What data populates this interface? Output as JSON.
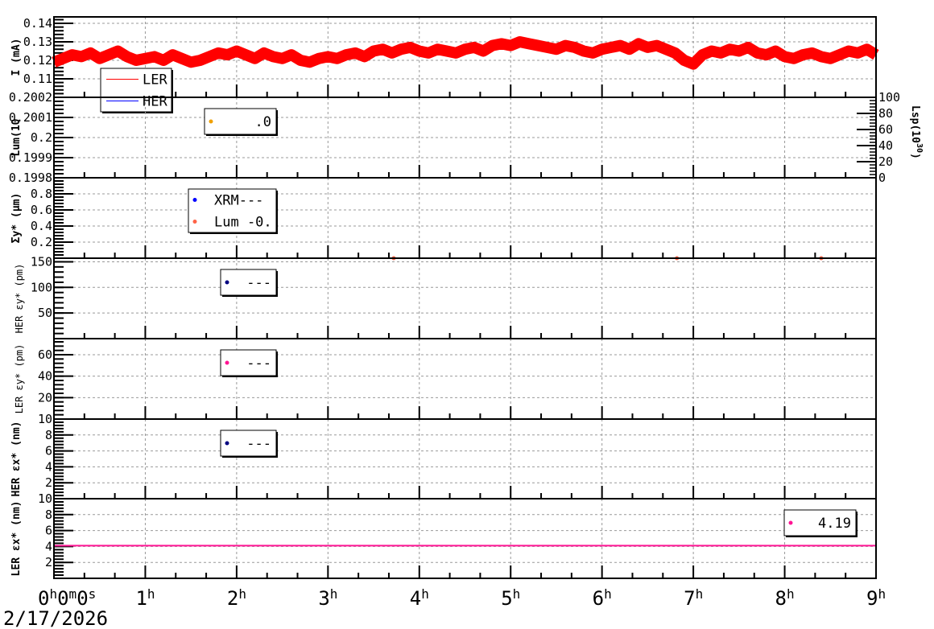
{
  "chart_data": [
    {
      "type": "line",
      "ylabel": "I (mA)",
      "ylim": [
        0.1,
        0.1435
      ],
      "yticks": [
        "0.11",
        "0.12",
        "0.13",
        "0.14"
      ],
      "ytick_values": [
        0.11,
        0.12,
        0.13,
        0.14
      ],
      "legend": [
        {
          "label": "LER",
          "color": "#ff0000"
        },
        {
          "label": "HER",
          "color": "#0000ff"
        }
      ],
      "series": [
        {
          "name": "LER",
          "color": "#ff0000",
          "x_hours": [
            0,
            0.1,
            0.2,
            0.3,
            0.4,
            0.5,
            0.6,
            0.7,
            0.8,
            0.9,
            1,
            1.1,
            1.2,
            1.3,
            1.4,
            1.5,
            1.6,
            1.7,
            1.8,
            1.9,
            2,
            2.1,
            2.2,
            2.3,
            2.4,
            2.5,
            2.6,
            2.7,
            2.8,
            2.9,
            3,
            3.1,
            3.2,
            3.3,
            3.4,
            3.5,
            3.6,
            3.7,
            3.8,
            3.9,
            4,
            4.1,
            4.2,
            4.3,
            4.4,
            4.5,
            4.6,
            4.7,
            4.8,
            4.9,
            5,
            5.1,
            5.2,
            5.3,
            5.4,
            5.5,
            5.6,
            5.7,
            5.8,
            5.9,
            6,
            6.1,
            6.2,
            6.3,
            6.4,
            6.5,
            6.6,
            6.7,
            6.8,
            6.9,
            7,
            7.1,
            7.2,
            7.3,
            7.4,
            7.5,
            7.6,
            7.7,
            7.8,
            7.9,
            8,
            8.1,
            8.2,
            8.3,
            8.4,
            8.5,
            8.6,
            8.7,
            8.8,
            8.9,
            9
          ],
          "values": [
            0.119,
            0.121,
            0.123,
            0.122,
            0.124,
            0.121,
            0.123,
            0.125,
            0.122,
            0.12,
            0.121,
            0.122,
            0.12,
            0.123,
            0.121,
            0.119,
            0.12,
            0.122,
            0.124,
            0.123,
            0.125,
            0.123,
            0.121,
            0.124,
            0.122,
            0.121,
            0.123,
            0.12,
            0.119,
            0.121,
            0.122,
            0.121,
            0.123,
            0.124,
            0.122,
            0.125,
            0.126,
            0.124,
            0.126,
            0.127,
            0.125,
            0.124,
            0.126,
            0.125,
            0.124,
            0.126,
            0.127,
            0.125,
            0.128,
            0.129,
            0.128,
            0.13,
            0.129,
            0.128,
            0.127,
            0.126,
            0.128,
            0.127,
            0.125,
            0.124,
            0.126,
            0.127,
            0.128,
            0.126,
            0.129,
            0.127,
            0.128,
            0.126,
            0.124,
            0.12,
            0.118,
            0.123,
            0.125,
            0.124,
            0.126,
            0.125,
            0.127,
            0.124,
            0.123,
            0.125,
            0.122,
            0.121,
            0.123,
            0.124,
            0.122,
            0.121,
            0.123,
            0.125,
            0.124,
            0.126,
            0.123
          ]
        }
      ]
    },
    {
      "type": "line",
      "ylabel": "Lum(10",
      "ylim": [
        0.1998,
        0.2002
      ],
      "yticks": [
        "0.2002",
        "0.2001",
        "0.2",
        "0.1999",
        "0.1998"
      ],
      "ytick_values": [
        0.2002,
        0.2001,
        0.2,
        0.1999,
        0.1998
      ],
      "y2label": "Lsp(10^30)",
      "y2label_main": "Lsp(10",
      "y2label_sup": "30",
      "y2label_end": ")",
      "y2lim": [
        0,
        100
      ],
      "y2ticks": [
        "0",
        "20",
        "40",
        "60",
        "80",
        "100"
      ],
      "y2tick_values": [
        0,
        20,
        40,
        60,
        80,
        100
      ],
      "legend": [
        {
          "label": ".0",
          "color": "#f0a000"
        }
      ],
      "series": [
        {
          "name": "Lsp",
          "axis": "y2",
          "color": "#3a6b1f",
          "x_hours": [
            0,
            9
          ],
          "values": [
            0,
            0
          ]
        }
      ]
    },
    {
      "type": "scatter",
      "ylabel": "Σy* (μm)",
      "ylim": [
        0,
        1
      ],
      "yticks": [
        "0.2",
        "0.4",
        "0.6",
        "0.8"
      ],
      "ytick_values": [
        0.2,
        0.4,
        0.6,
        0.8
      ],
      "legend": [
        {
          "label": "XRM---",
          "color": "#0000ff"
        },
        {
          "label": "Lum -0.",
          "color": "#ff6347"
        }
      ],
      "series": [
        {
          "name": "Lum",
          "color": "#ff6347",
          "x_hours": [
            3.72,
            6.82,
            8.4
          ],
          "values": [
            0,
            0,
            0
          ]
        }
      ]
    },
    {
      "type": "scatter",
      "ylabel": "HER εy* (pm)",
      "ylim": [
        0,
        157
      ],
      "yticks": [
        "50",
        "100",
        "150"
      ],
      "ytick_values": [
        50,
        100,
        150
      ],
      "legend": [
        {
          "label": "---",
          "color": "#000080"
        }
      ],
      "series": []
    },
    {
      "type": "scatter",
      "ylabel": "LER εy* (pm)",
      "ylim": [
        0,
        75
      ],
      "yticks": [
        "20",
        "40",
        "60"
      ],
      "ytick_values": [
        20,
        40,
        60
      ],
      "legend": [
        {
          "label": "---",
          "color": "#ff1493"
        }
      ],
      "series": []
    },
    {
      "type": "scatter",
      "ylabel": "HER εx* (nm)",
      "ylim": [
        0,
        10
      ],
      "yticks": [
        "2",
        "4",
        "6",
        "8",
        "10"
      ],
      "ytick_values": [
        2,
        4,
        6,
        8,
        10
      ],
      "legend": [
        {
          "label": "---",
          "color": "#000080"
        }
      ],
      "series": []
    },
    {
      "type": "line",
      "ylabel": "LER εx* (nm)",
      "ylim": [
        0,
        10
      ],
      "yticks": [
        "2",
        "4",
        "6",
        "8",
        "10"
      ],
      "ytick_values": [
        2,
        4,
        6,
        8,
        10
      ],
      "legend": [
        {
          "label": "4.19",
          "color": "#ff1493"
        }
      ],
      "series": [
        {
          "name": "LER εx",
          "color": "#ff1493",
          "x_hours": [
            0,
            9
          ],
          "values": [
            4.1,
            4.1
          ]
        }
      ]
    }
  ],
  "xaxis": {
    "xlim_hours": [
      0,
      9
    ],
    "first_label": [
      "0",
      "h",
      "0",
      "m",
      "0",
      "s"
    ],
    "labels": [
      "1",
      "2",
      "3",
      "4",
      "5",
      "6",
      "7",
      "8",
      "9"
    ],
    "unit": "h",
    "date": "2/17/2026"
  }
}
